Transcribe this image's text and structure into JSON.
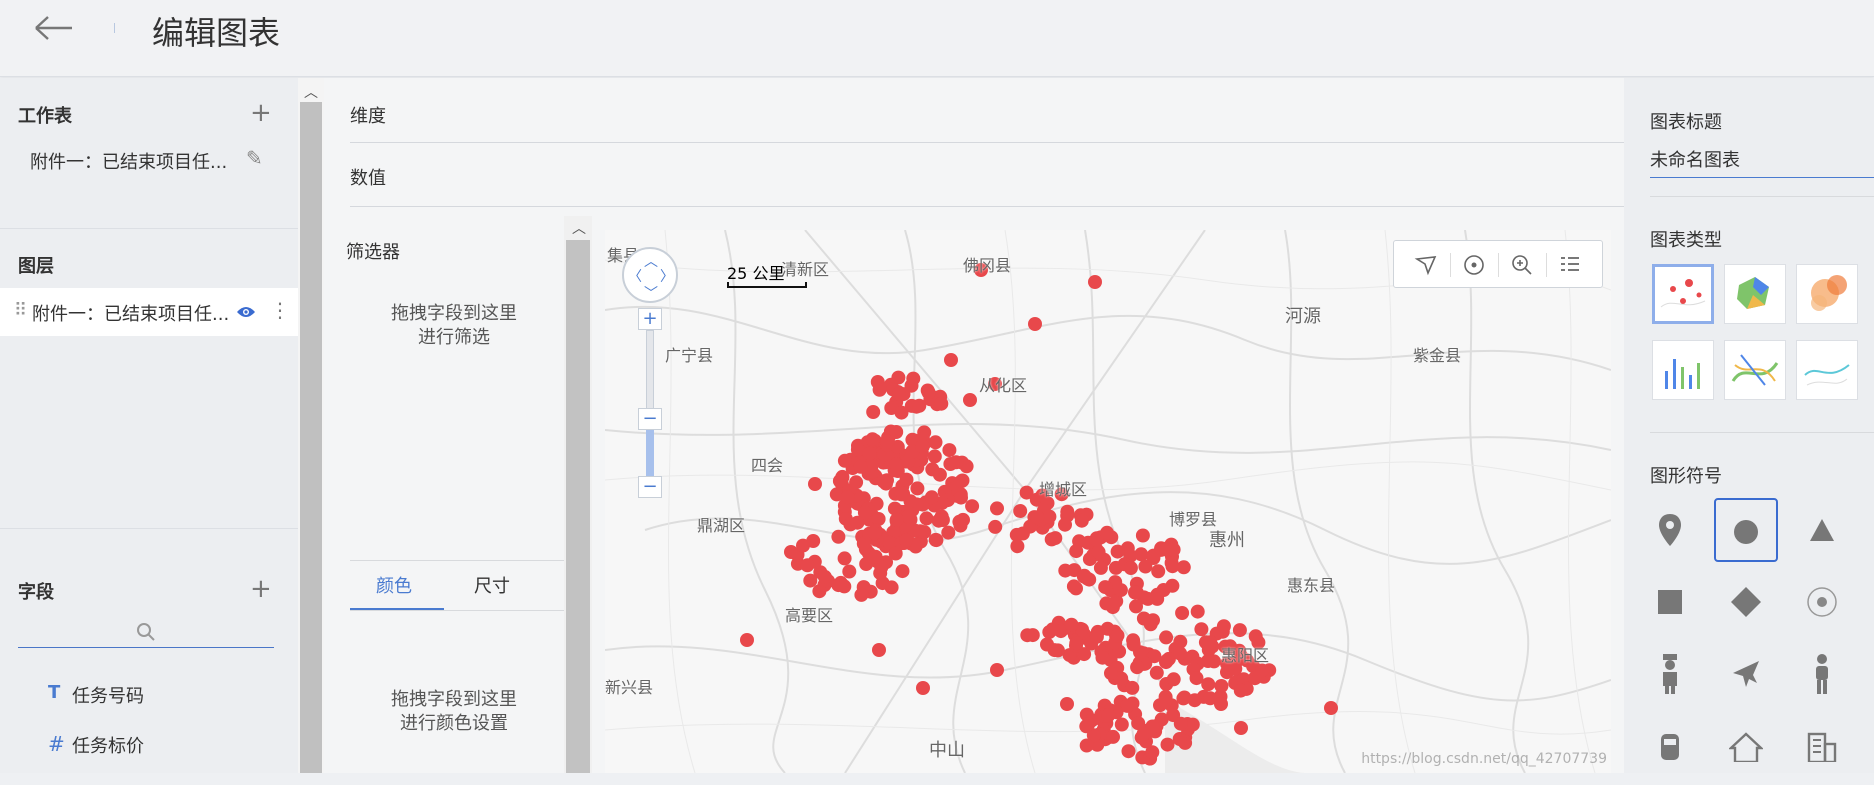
{
  "header": {
    "back_icon": "arrow-left-icon",
    "title": "编辑图表"
  },
  "left": {
    "worksheet_heading": "工作表",
    "worksheet_item": "附件一：已结束项目任...",
    "layers_heading": "图层",
    "layer_item": "附件一：已结束项目任...",
    "fields_heading": "字段",
    "fields": [
      {
        "type": "T",
        "label": "任务号码"
      },
      {
        "type": "#",
        "label": "任务标价"
      }
    ]
  },
  "middle": {
    "dimension_label": "维度",
    "value_label": "数值",
    "filter_heading": "筛选器",
    "filter_hint_line1": "拖拽字段到这里",
    "filter_hint_line2": "进行筛选",
    "tab_color": "颜色",
    "tab_size": "尺寸",
    "color_hint_line1": "拖拽字段到这里",
    "color_hint_line2": "进行颜色设置"
  },
  "map": {
    "scale_label": "25 公里",
    "watermark": "https://blog.csdn.net/qq_42707739",
    "point_color": "#e8484b",
    "place_names": [
      "集县",
      "清新区",
      "佛冈县",
      "河源",
      "紫金县",
      "广宁县",
      "从化区",
      "四会",
      "增城区",
      "博罗县",
      "惠州",
      "鼎湖区",
      "惠东县",
      "高要区",
      "惠阳区",
      "新兴县",
      "中山"
    ]
  },
  "right": {
    "chart_title_label": "图表标题",
    "chart_title_value": "未命名图表",
    "chart_type_label": "图表类型",
    "symbol_label": "图形符号",
    "accent_color": "#4a7bd0"
  }
}
